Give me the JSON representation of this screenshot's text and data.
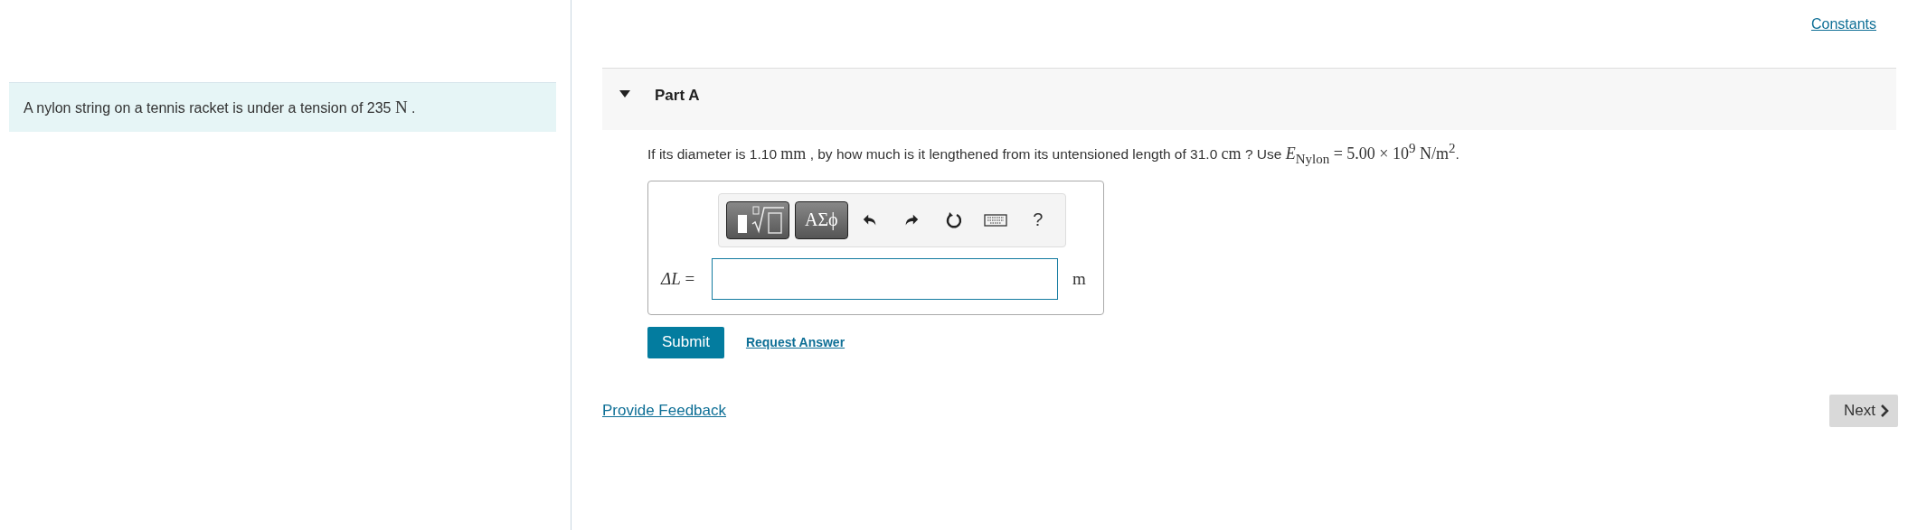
{
  "intro": {
    "segments": [
      {
        "kind": "text",
        "text": "A nylon string on a tennis racket is under a tension of 235 "
      },
      {
        "kind": "math",
        "text": "N"
      },
      {
        "kind": "text",
        "text": " ."
      }
    ]
  },
  "constants_link": "Constants",
  "part": {
    "title": "Part A",
    "expanded": true,
    "question": [
      {
        "kind": "text",
        "text": "If its diameter is 1.10 "
      },
      {
        "kind": "math",
        "text": "mm"
      },
      {
        "kind": "text",
        "text": " , by how much is it lengthened from its untensioned length of 31.0 "
      },
      {
        "kind": "math",
        "text": "cm"
      },
      {
        "kind": "text",
        "text": " ? Use "
      },
      {
        "kind": "math",
        "text": "*E*$_{Nylon}$ = 5.00 × 10$^{9}$ N/m$^{2}$"
      },
      {
        "kind": "text",
        "text": "."
      }
    ],
    "toolbar": [
      {
        "kind": "templates"
      },
      {
        "kind": "symbols",
        "label": "ΑΣϕ"
      },
      {
        "kind": "undo"
      },
      {
        "kind": "redo"
      },
      {
        "kind": "reset"
      },
      {
        "kind": "keyboard"
      },
      {
        "kind": "help",
        "label": "?"
      }
    ],
    "answer_label": "*ΔL* =",
    "unit": "m",
    "buttons": {
      "submit": "Submit",
      "request": "Request Answer"
    }
  },
  "feedback_link": "Provide Feedback",
  "next_button": "Next"
}
